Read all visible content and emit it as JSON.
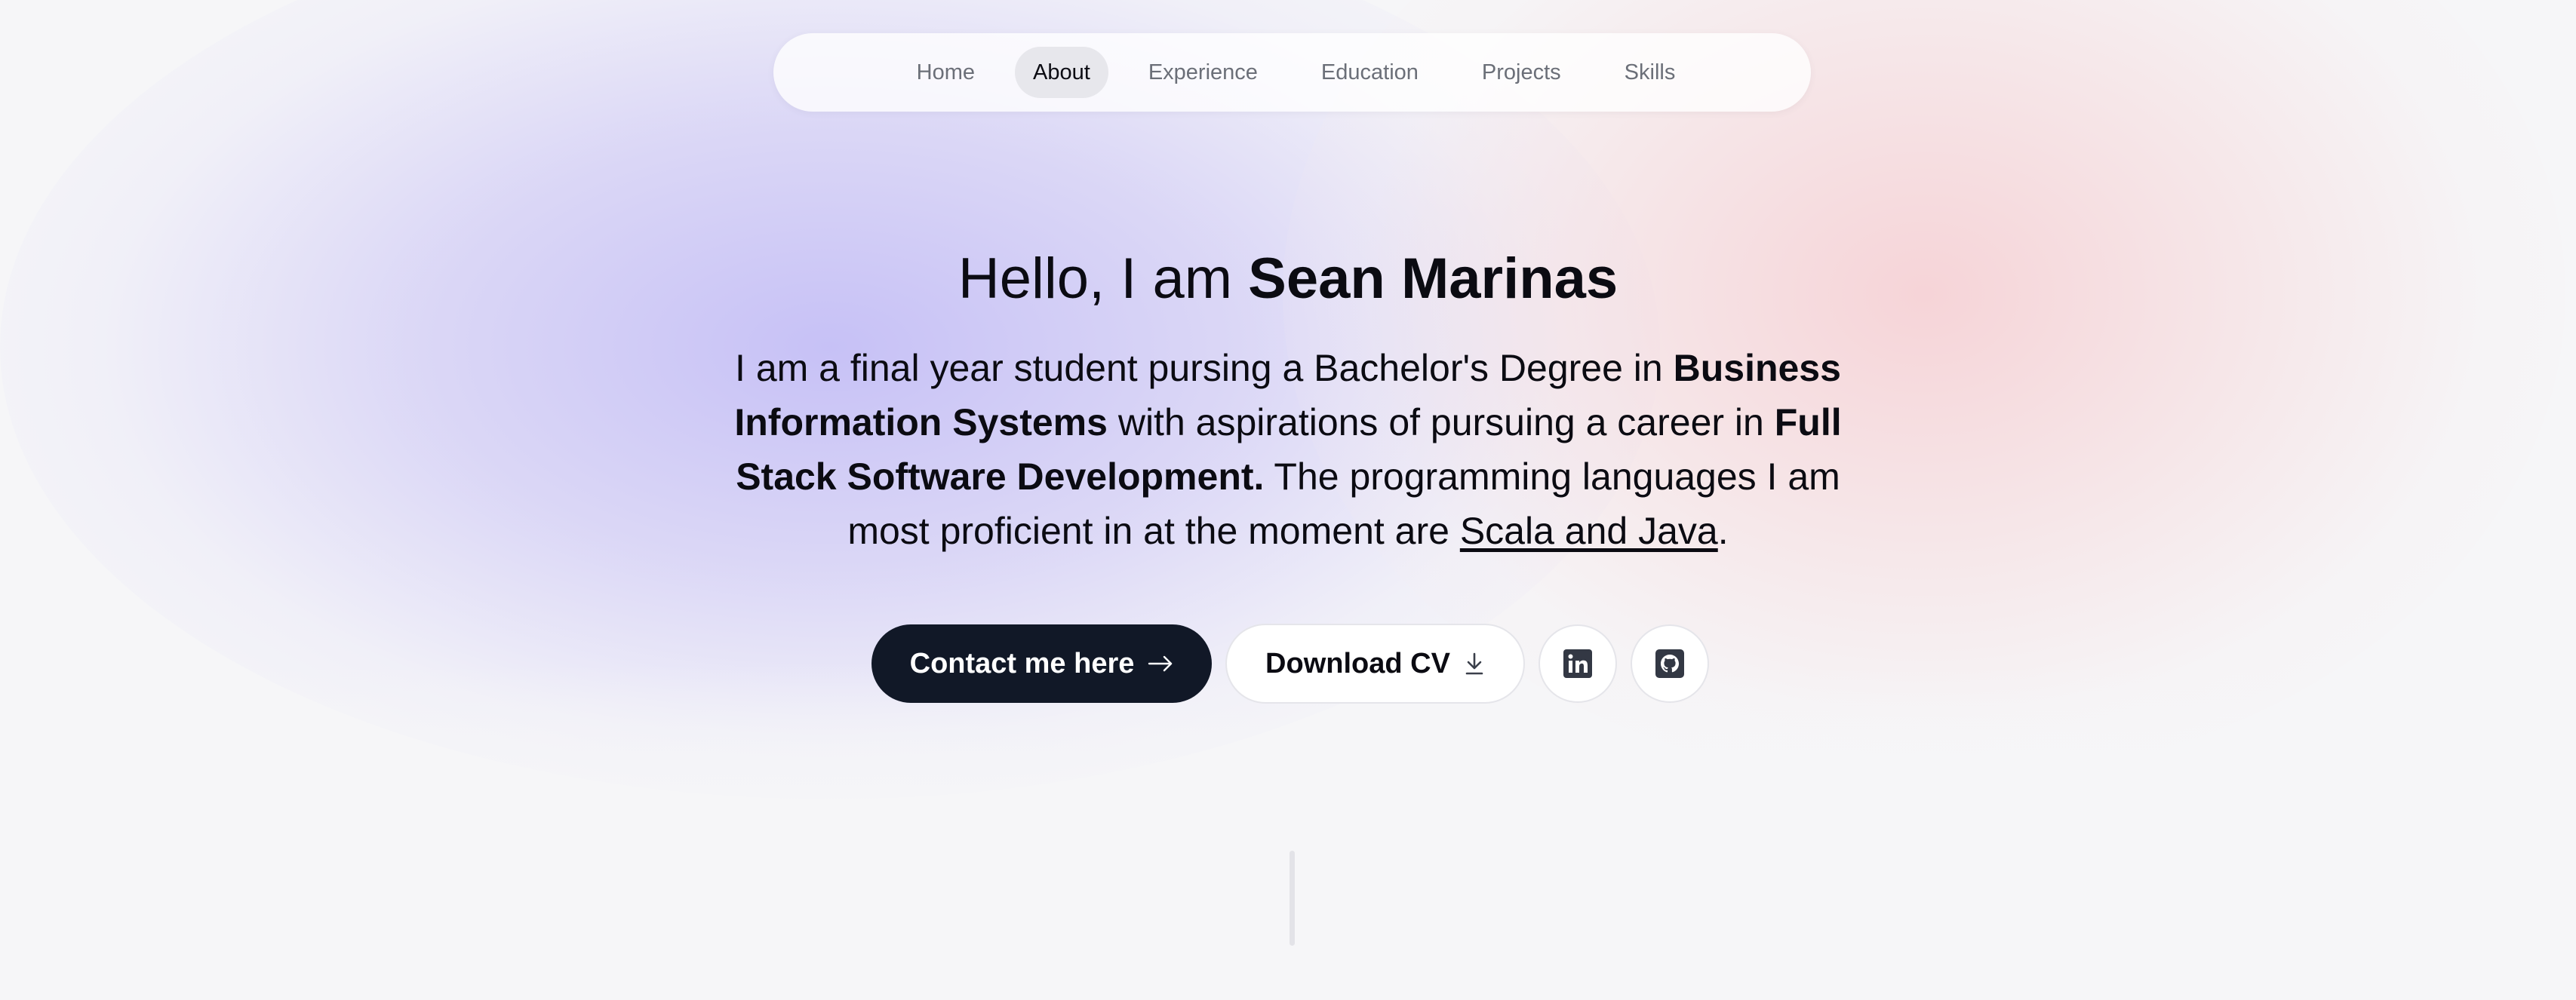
{
  "nav": {
    "items": [
      {
        "label": "Home",
        "active": false
      },
      {
        "label": "About",
        "active": true
      },
      {
        "label": "Experience",
        "active": false
      },
      {
        "label": "Education",
        "active": false
      },
      {
        "label": "Projects",
        "active": false
      },
      {
        "label": "Skills",
        "active": false
      }
    ]
  },
  "hero": {
    "greeting": "Hello, I am ",
    "name": "Sean Marinas",
    "intro": {
      "part1": "I am a final year student pursing a Bachelor's Degree in ",
      "degree": "Business Information Systems",
      "part2": " with aspirations of pursuing a career in ",
      "career": "Full Stack Software Development.",
      "part3": " The programming languages I am most proficient in at the moment are ",
      "languages": "Scala and Java",
      "part4": "."
    }
  },
  "actions": {
    "contact_label": "Contact me here",
    "contact_icon": "arrow-right-icon",
    "download_label": "Download CV",
    "download_icon": "download-icon",
    "linkedin_icon": "linkedin-icon",
    "github_icon": "github-icon"
  },
  "colors": {
    "primary_button": "#111827",
    "background": "#f6f6f8",
    "accent_purple": "#c4bef6",
    "accent_pink": "#f6ced2"
  }
}
